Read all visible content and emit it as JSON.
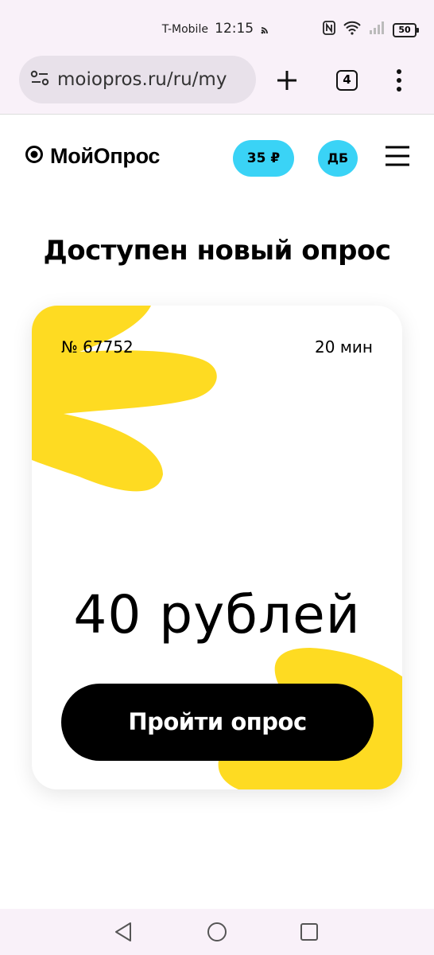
{
  "status_bar": {
    "carrier": "T-Mobile",
    "time": "12:15",
    "battery": "50"
  },
  "browser": {
    "url": "moiopros.ru/ru/my",
    "tab_count": "4"
  },
  "header": {
    "logo": "МойОпрос",
    "balance": "35 ₽",
    "avatar_initials": "ДБ"
  },
  "main": {
    "heading": "Доступен новый опрос",
    "survey": {
      "number": "№ 67752",
      "duration": "20 мин",
      "reward": "40 рублей",
      "cta_label": "Пройти опрос"
    }
  },
  "colors": {
    "accent_cyan": "#3ad3f6",
    "accent_yellow": "#fedb22",
    "button_black": "#000000",
    "chrome_bg": "#f9f1f9"
  },
  "icons": [
    "cast-icon",
    "nfc-icon",
    "wifi-icon",
    "signal-icon",
    "battery-icon",
    "site-settings-icon",
    "plus-icon",
    "tabs-icon",
    "more-vert-icon",
    "logo-icon",
    "menu-icon",
    "back-icon",
    "home-icon",
    "recents-icon"
  ]
}
